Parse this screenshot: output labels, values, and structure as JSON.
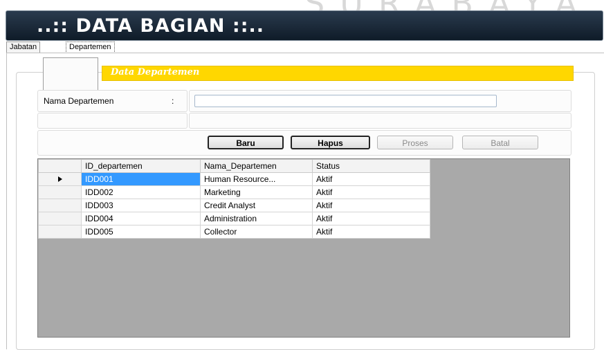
{
  "watermark": "SURABAYA",
  "header": {
    "title": "..:: DATA BAGIAN ::.."
  },
  "tabs": [
    {
      "label": "Jabatan",
      "active": false
    },
    {
      "label": "Departemen",
      "active": true
    }
  ],
  "section": {
    "title": "Data Departemen"
  },
  "form": {
    "nama_label": "Nama Departemen",
    "colon": ":",
    "nama_value": ""
  },
  "buttons": {
    "baru": "Baru",
    "hapus": "Hapus",
    "proses": "Proses",
    "batal": "Batal"
  },
  "grid": {
    "columns": [
      "ID_departemen",
      "Nama_Departemen",
      "Status"
    ],
    "selected_row": 0,
    "rows": [
      {
        "id": "IDD001",
        "nama": "Human Resource...",
        "status": "Aktif"
      },
      {
        "id": "IDD002",
        "nama": "Marketing",
        "status": "Aktif"
      },
      {
        "id": "IDD003",
        "nama": "Credit Analyst",
        "status": "Aktif"
      },
      {
        "id": "IDD004",
        "nama": "Administration",
        "status": "Aktif"
      },
      {
        "id": "IDD005",
        "nama": "Collector",
        "status": "Aktif"
      }
    ]
  },
  "colors": {
    "header_bar": "#ffd700",
    "title_bg": "#16222f",
    "selection": "#3399ff",
    "grid_bg": "#a9a9a9"
  }
}
